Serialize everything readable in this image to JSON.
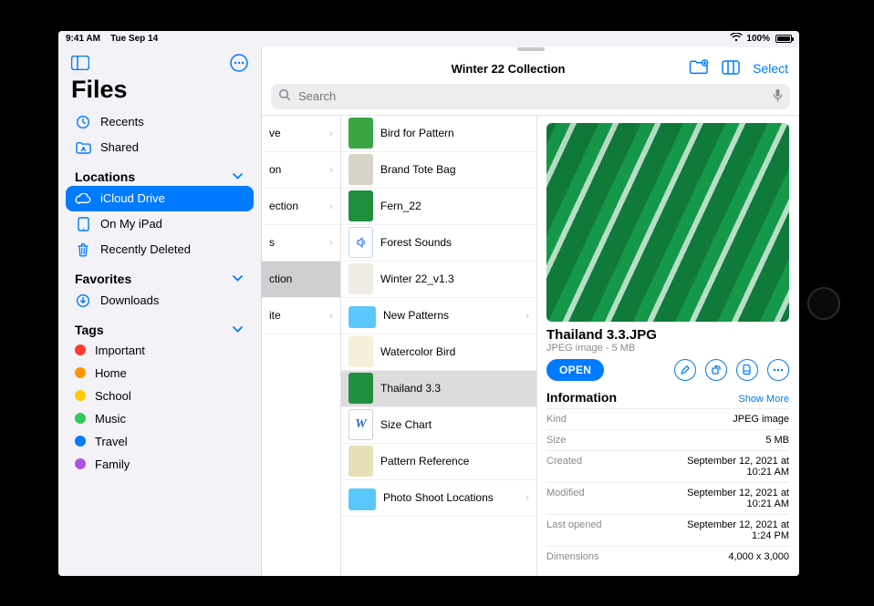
{
  "status": {
    "time": "9:41 AM",
    "date": "Tue Sep 14",
    "battery_pct": "100%"
  },
  "sidebar": {
    "title": "Files",
    "top": {
      "recents": "Recents",
      "shared": "Shared"
    },
    "sections": {
      "locations": {
        "label": "Locations",
        "items": [
          {
            "label": "iCloud Drive",
            "selected": true
          },
          {
            "label": "On My iPad"
          },
          {
            "label": "Recently Deleted"
          }
        ]
      },
      "favorites": {
        "label": "Favorites",
        "items": [
          {
            "label": "Downloads"
          }
        ]
      },
      "tags": {
        "label": "Tags",
        "items": [
          {
            "label": "Important",
            "color": "#ff3b30"
          },
          {
            "label": "Home",
            "color": "#ff9500"
          },
          {
            "label": "School",
            "color": "#ffcc00"
          },
          {
            "label": "Music",
            "color": "#34c759"
          },
          {
            "label": "Travel",
            "color": "#007aff"
          },
          {
            "label": "Family",
            "color": "#af52de"
          }
        ]
      }
    }
  },
  "header": {
    "title": "Winter 22 Collection",
    "select_label": "Select",
    "search_placeholder": "Search"
  },
  "colA": [
    {
      "label": "ve"
    },
    {
      "label": "on"
    },
    {
      "label": "ection"
    },
    {
      "label": "s"
    },
    {
      "label": "ction",
      "selected": true
    },
    {
      "label": "ite"
    }
  ],
  "colB": [
    {
      "label": "Bird for Pattern",
      "kind": "img",
      "swatch": "#3aa641"
    },
    {
      "label": "Brand Tote Bag",
      "kind": "img",
      "swatch": "#d8d4c6"
    },
    {
      "label": "Fern_22",
      "kind": "img",
      "swatch": "#1f8f3e"
    },
    {
      "label": "Forest Sounds",
      "kind": "audio",
      "swatch": "#ffffff"
    },
    {
      "label": "Winter 22_v1.3",
      "kind": "doc",
      "swatch": "#efece6"
    },
    {
      "label": "New Patterns",
      "kind": "folder",
      "chevron": true
    },
    {
      "label": "Watercolor Bird",
      "kind": "img",
      "swatch": "#f5efd8"
    },
    {
      "label": "Thailand 3.3",
      "kind": "img",
      "swatch": "#1f8f3e",
      "selected": true
    },
    {
      "label": "Size Chart",
      "kind": "word",
      "swatch": "#ffffff"
    },
    {
      "label": "Pattern Reference",
      "kind": "img",
      "swatch": "#e6dfb8"
    },
    {
      "label": "Photo Shoot Locations",
      "kind": "folder",
      "chevron": true
    }
  ],
  "detail": {
    "title": "Thailand 3.3.JPG",
    "subtitle": "JPEG image - 5 MB",
    "open_label": "OPEN",
    "info_label": "Information",
    "show_more": "Show More",
    "rows": [
      {
        "k": "Kind",
        "v": "JPEG image"
      },
      {
        "k": "Size",
        "v": "5 MB"
      },
      {
        "k": "Created",
        "v": "September 12, 2021 at 10:21 AM"
      },
      {
        "k": "Modified",
        "v": "September 12, 2021 at 10:21 AM"
      },
      {
        "k": "Last opened",
        "v": "September 12, 2021 at 1:24 PM"
      },
      {
        "k": "Dimensions",
        "v": "4,000 x 3,000"
      }
    ]
  }
}
